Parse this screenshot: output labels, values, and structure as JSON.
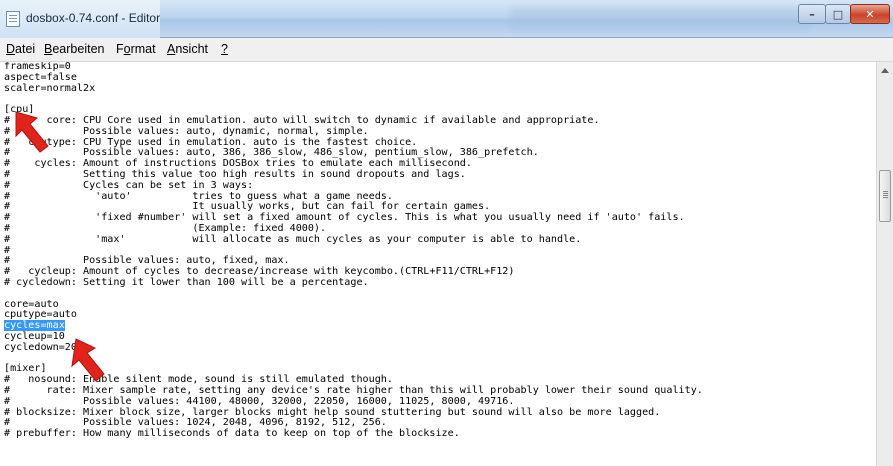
{
  "window": {
    "title": "dosbox-0.74.conf - Editor",
    "controls": {
      "minimize": "–",
      "maximize": "□",
      "close": "✕"
    },
    "close_color": "#c8442a"
  },
  "menu": {
    "items": [
      {
        "label": "Datei",
        "accel": "D"
      },
      {
        "label": "Bearbeiten",
        "accel": "B"
      },
      {
        "label": "Format",
        "accel": "o"
      },
      {
        "label": "Ansicht",
        "accel": "A"
      },
      {
        "label": "?",
        "accel": "?"
      }
    ]
  },
  "editor": {
    "selection_color": "#3399ff",
    "before": "frameskip=0\naspect=false\nscaler=normal2x\n\n[cpu]\n#      core: CPU Core used in emulation. auto will switch to dynamic if available and appropriate.\n#            Possible values: auto, dynamic, normal, simple.\n#   cputype: CPU Type used in emulation. auto is the fastest choice.\n#            Possible values: auto, 386, 386_slow, 486_slow, pentium_slow, 386_prefetch.\n#    cycles: Amount of instructions DOSBox tries to emulate each millisecond.\n#            Setting this value too high results in sound dropouts and lags.\n#            Cycles can be set in 3 ways:\n#              'auto'          tries to guess what a game needs.\n#                              It usually works, but can fail for certain games.\n#              'fixed #number' will set a fixed amount of cycles. This is what you usually need if 'auto' fails.\n#                              (Example: fixed 4000).\n#              'max'           will allocate as much cycles as your computer is able to handle.\n#\n#            Possible values: auto, fixed, max.\n#   cycleup: Amount of cycles to decrease/increase with keycombo.(CTRL+F11/CTRL+F12)\n# cycledown: Setting it lower than 100 will be a percentage.\n\ncore=auto\ncputype=auto\n",
    "selected": "cycles=max",
    "after": "\ncycleup=10\ncycledown=20\n\n[mixer]\n#   nosound: Enable silent mode, sound is still emulated though.\n#      rate: Mixer sample rate, setting any device's rate higher than this will probably lower their sound quality.\n#            Possible values: 44100, 48000, 32000, 22050, 16000, 11025, 8000, 49716.\n# blocksize: Mixer block size, larger blocks might help sound stuttering but sound will also be more lagged.\n#            Possible values: 1024, 2048, 4096, 8192, 512, 256.\n# prebuffer: How many milliseconds of data to keep on top of the blocksize."
  },
  "annotations": {
    "arrow_color": "#e0241b",
    "arrows": [
      "red-arrow-cpu-section",
      "red-arrow-cycles-line"
    ]
  }
}
